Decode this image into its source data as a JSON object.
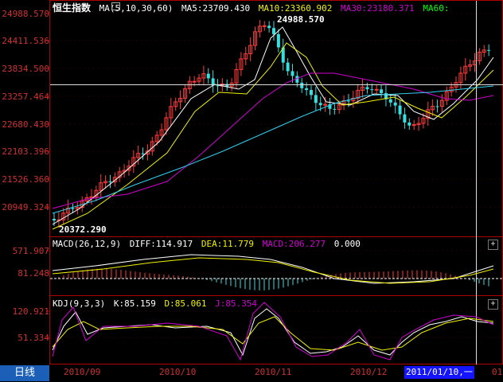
{
  "main_panel": {
    "title": "恒生指数",
    "ma_label": "MA(5,10,30,60)",
    "ma5": "MA5:23709.430",
    "ma10": "MA10:23360.902",
    "ma30": "MA30:23180.371",
    "ma60": "MA60:",
    "y_labels": [
      "24988.570",
      "24411.536",
      "23834.500",
      "23257.464",
      "22680.430",
      "22103.396",
      "21526.360",
      "20949.324"
    ],
    "high_label": "24988.570",
    "low_label": "20372.290"
  },
  "macd_panel": {
    "label": "MACD(26,12,9)",
    "diff": "DIFF:114.917",
    "dea": "DEA:11.779",
    "macd": "MACD:206.277",
    "zero": "0.000",
    "y_labels": [
      "571.907",
      "81.248"
    ]
  },
  "kdj_panel": {
    "label": "KDJ(9,3,3)",
    "k": "K:85.159",
    "d": "D:85.061",
    "j": "J:85.354",
    "y_labels": [
      "120.921",
      "51.334"
    ]
  },
  "bottom": {
    "period_tab": "日线",
    "x_labels": [
      "2010/09",
      "2010/10",
      "2010/11",
      "2010/12"
    ],
    "cursor_date": "2011/01/10,一",
    "trailing_label": "01"
  },
  "colors": {
    "up": "#ff3b3b",
    "down": "#35e0e0",
    "ma5": "#ffffff",
    "ma10": "#f0f000",
    "ma30": "#d000d0",
    "ma60": "#00ff00",
    "axis": "#b00000"
  }
}
